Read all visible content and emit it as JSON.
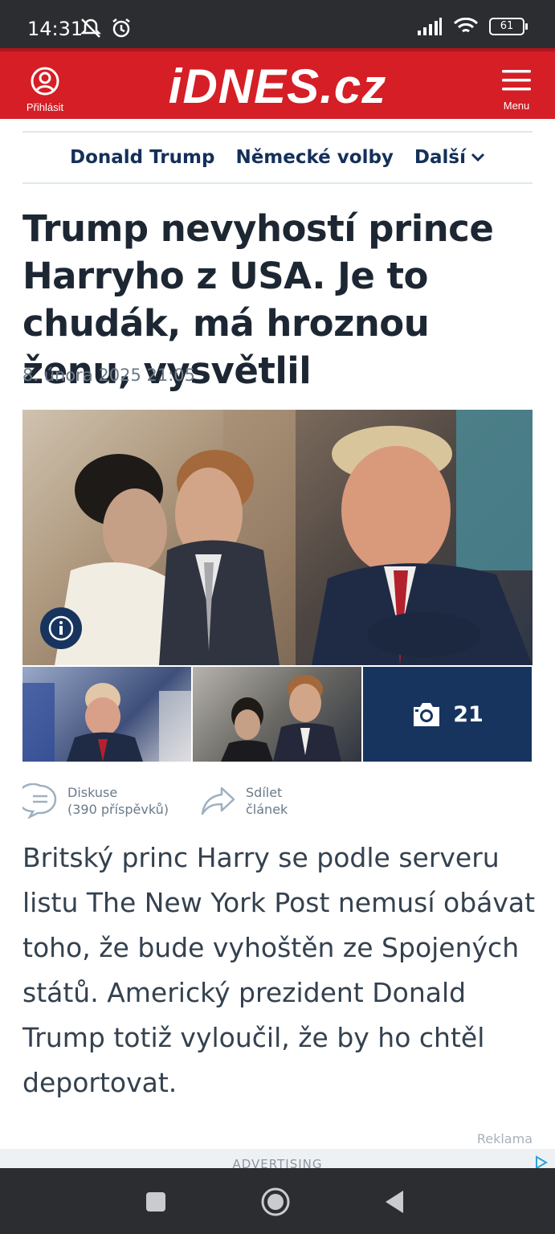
{
  "status_bar": {
    "time": "14:31",
    "battery": "61",
    "icons": [
      "mute-icon",
      "alarm-icon",
      "signal-icon",
      "wifi-icon",
      "battery-icon"
    ]
  },
  "header": {
    "login_label": "Přihlásit",
    "logo": "iDNES.cz",
    "menu_label": "Menu",
    "brand_color": "#d51e25"
  },
  "topics": [
    "Donald Trump",
    "Německé volby",
    "Další"
  ],
  "article": {
    "title": "Trump nevyhostí prince Harryho z USA. Je to chudák, má hroznou ženu, vysvětlil",
    "date": "8. února 2025  21:05",
    "photo_count": "21",
    "discussion_label": "Diskuse",
    "discussion_count": "(390 příspěvků)",
    "share_line1": "Sdílet",
    "share_line2": "článek",
    "perex": "Britský princ Harry se podle serveru listu The New York Post nemusí obávat toho, že bude vyhoštěn ze Spojených států. Americký prezident Donald Trump totiž vyloučil, že by ho chtěl deportovat."
  },
  "ad": {
    "label": "Reklama",
    "advertising": "ADVERTISING"
  },
  "colors": {
    "accent_dark": "#17345f",
    "text": "#1d2733"
  }
}
